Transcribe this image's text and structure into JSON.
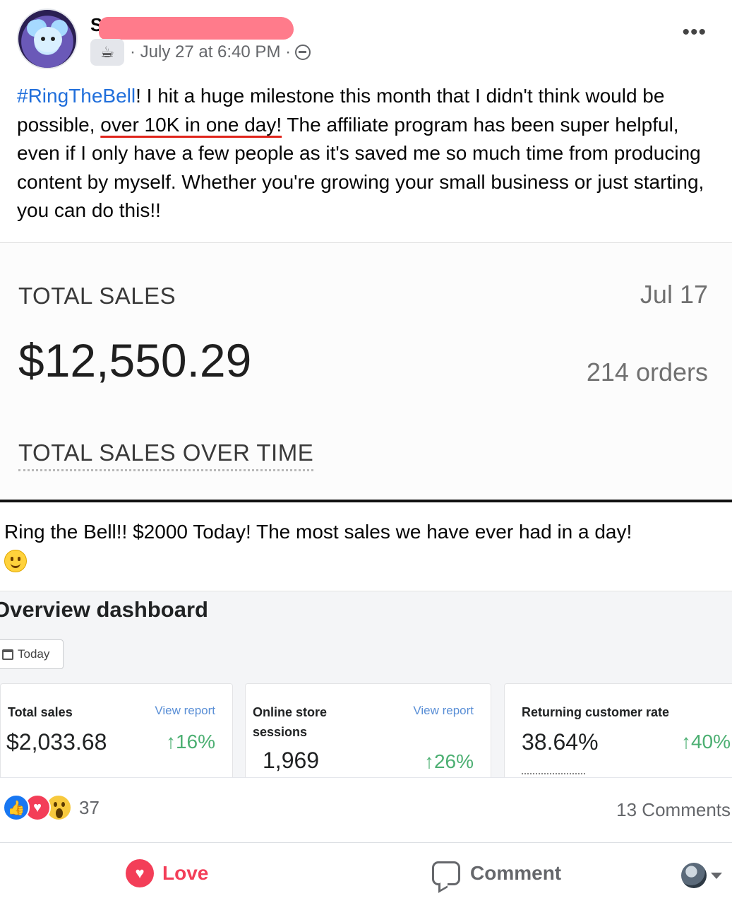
{
  "post": {
    "author_initial": "S",
    "timestamp": "· July 27 at 6:40 PM ·",
    "group_icon": "coffee-cup-icon",
    "privacy_icon": "globe-icon",
    "more_label": "•••",
    "text": {
      "hashtag": "#RingTheBell",
      "part1": "! I hit a huge milestone this month that I didn't think would be possible, ",
      "highlight": "over 10K in one day!",
      "part2": " The affiliate program has been super helpful, even if I only have a few people as it's saved me so much time from producing content by myself. Whether you're growing your small business or just starting, you can do this!!"
    }
  },
  "screenshot1": {
    "label": "TOTAL SALES",
    "date": "Jul 17",
    "value": "$12,550.29",
    "orders": "214 orders",
    "over_time_label": "TOTAL SALES OVER TIME"
  },
  "screenshot2": {
    "caption": "Ring the Bell!! $2000 Today! The most sales we have ever had in a day!",
    "dashboard_title": "Overview dashboard",
    "date_filter": "Today",
    "cards": [
      {
        "title": "Total sales",
        "link": "View report",
        "value": "$2,033.68",
        "change": "↑16%"
      },
      {
        "title": "Online store sessions",
        "link": "View report",
        "value": "1,969",
        "change": "↑26%"
      },
      {
        "title": "Returning customer rate",
        "link": "",
        "value": "38.64%",
        "change": "↑40%"
      }
    ]
  },
  "reactions": {
    "types": [
      "like",
      "love",
      "wow"
    ],
    "count": "37",
    "comments": "13 Comments"
  },
  "actions": {
    "love_label": "Love",
    "comment_label": "Comment"
  },
  "colors": {
    "hashtag": "#216fdb",
    "love": "#f33e58",
    "like": "#1877f2",
    "positive": "#4caf72",
    "underline": "#e0241b",
    "redaction": "#ff7b8b"
  }
}
